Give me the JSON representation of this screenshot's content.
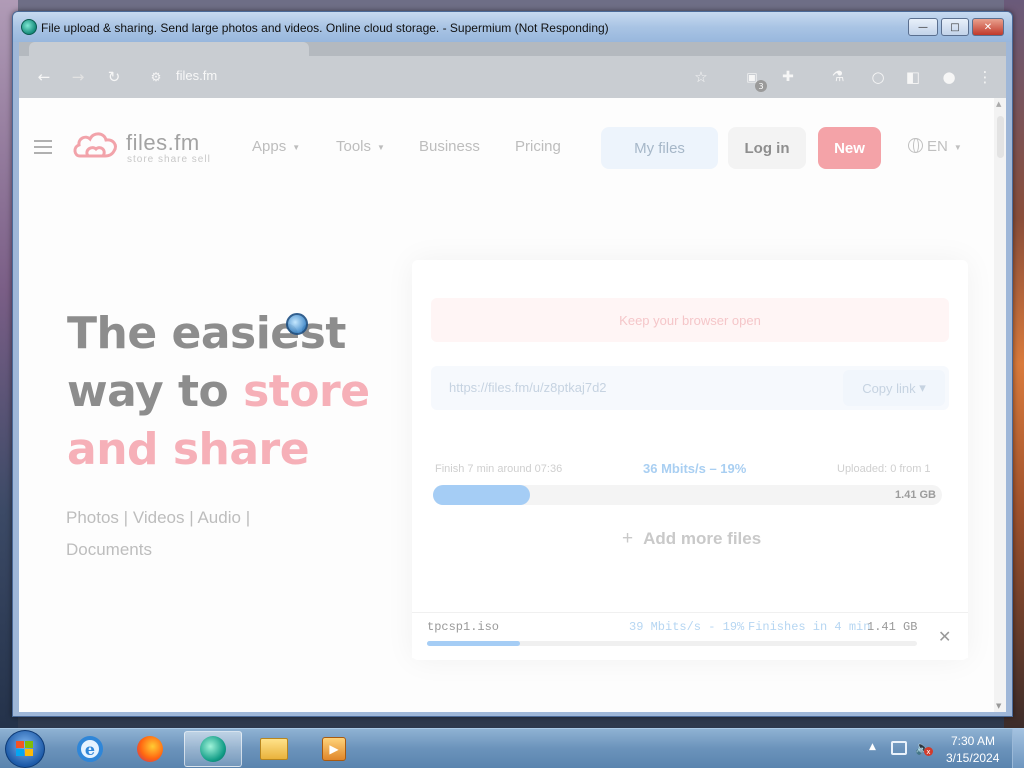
{
  "window": {
    "title": "File upload & sharing. Send large photos and videos. Online cloud storage. - Supermium (Not Responding)",
    "min_glyph": "—",
    "max_glyph": "□",
    "close_glyph": "✕"
  },
  "browser": {
    "url": "files.fm",
    "back_glyph": "←",
    "forward_glyph": "→",
    "reload_glyph": "↻",
    "site_info_glyph": "⚙",
    "bookmark_glyph": "☆",
    "extensions_badge_count": "3",
    "menu_glyph": "⋮"
  },
  "nav": {
    "logo_name": "files.fm",
    "logo_tagline": "store share sell",
    "links": {
      "apps": "Apps",
      "tools": "Tools",
      "business": "Business",
      "pricing": "Pricing"
    },
    "caret_glyph": "▼",
    "my_files": "My files",
    "log_in": "Log in",
    "new": "New",
    "language": "EN"
  },
  "hero": {
    "line1": "The easiest",
    "line2_plain": "way to ",
    "line2_pink": "store",
    "line3_pink": "and share",
    "sub_photos": "Photos",
    "sub_videos": "Videos",
    "sub_audio": "Audio",
    "sub_documents": "Documents",
    "separator": "|"
  },
  "upload": {
    "keep_open": "Keep your browser open",
    "share_link": "https://files.fm/u/z8ptkaj7d2",
    "copy_link": "Copy link",
    "copy_caret": "▾",
    "finish_text": "Finish 7 min around 07:36",
    "speed_text": "36 Mbits/s – 19%",
    "uploaded_text": "Uploaded: 0 from 1",
    "progress_fraction": 0.19,
    "total_size": "1.41 GB",
    "add_more_plus": "+",
    "add_more": "Add more files"
  },
  "file_row": {
    "name": "tpcsp1.iso",
    "speed": "39 Mbits/s - 19%",
    "finishes": "Finishes in 4 min",
    "size": "1.41 GB",
    "progress_fraction": 0.19,
    "close_glyph": "✕"
  },
  "taskbar": {
    "apps": [
      "internet-explorer",
      "firefox",
      "supermium",
      "file-explorer",
      "media-player"
    ],
    "ie_letter": "e",
    "tray_arrow": "▲",
    "volume_glyph": "🔈",
    "mute_glyph": "x",
    "time": "7:30 AM",
    "date": "3/15/2024"
  }
}
